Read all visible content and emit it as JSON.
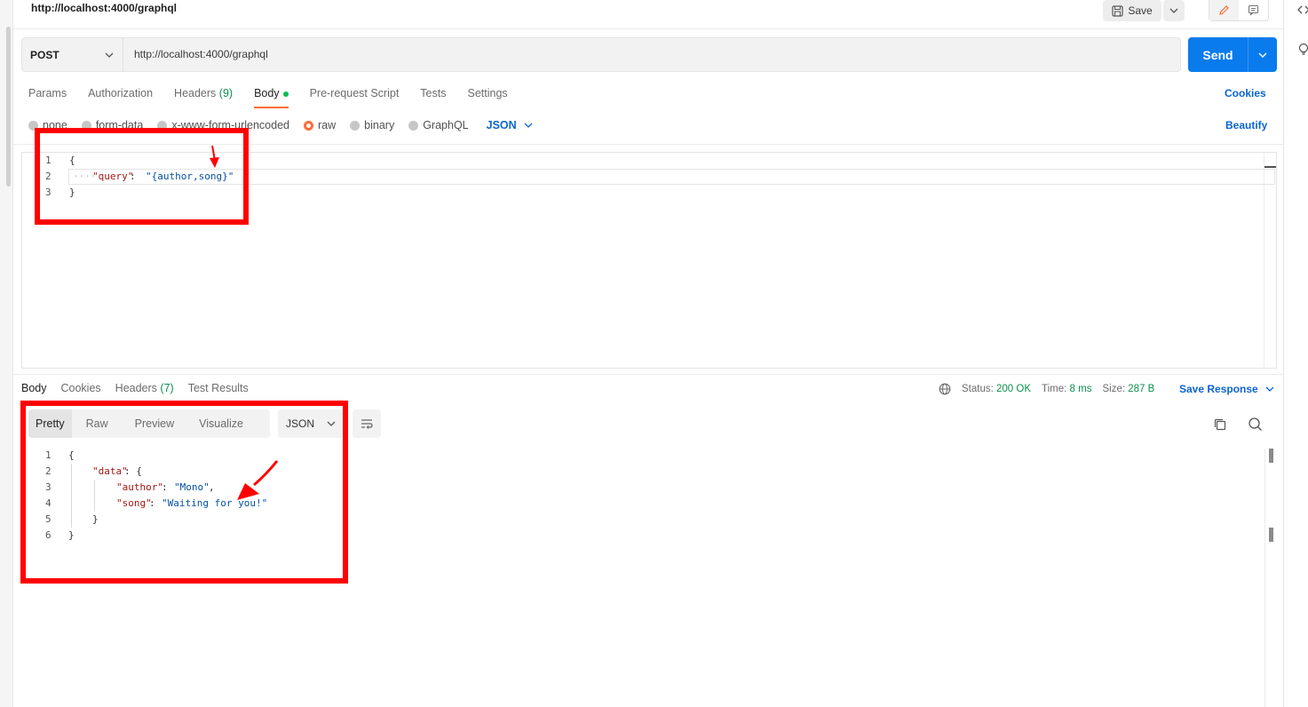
{
  "header": {
    "title": "http://localhost:4000/graphql",
    "save_label": "Save"
  },
  "request": {
    "method": "POST",
    "url": "http://localhost:4000/graphql",
    "send_label": "Send",
    "tabs": [
      {
        "label": "Params"
      },
      {
        "label": "Authorization"
      },
      {
        "label": "Headers",
        "count": "(9)"
      },
      {
        "label": "Body"
      },
      {
        "label": "Pre-request Script"
      },
      {
        "label": "Tests"
      },
      {
        "label": "Settings"
      }
    ],
    "cookies_label": "Cookies",
    "body_types": [
      "none",
      "form-data",
      "x-www-form-urlencoded",
      "raw",
      "binary",
      "GraphQL"
    ],
    "selected_body_type": "raw",
    "raw_format": "JSON",
    "beautify_label": "Beautify",
    "editor": {
      "line_numbers": [
        "1",
        "2",
        "3"
      ],
      "open_brace": "{",
      "key": "\"query\"",
      "colon": ": ",
      "value": "\"{author,song}\"",
      "close_brace": "}"
    }
  },
  "response": {
    "tabs": [
      {
        "label": "Body"
      },
      {
        "label": "Cookies"
      },
      {
        "label": "Headers",
        "count": "(7)"
      },
      {
        "label": "Test Results"
      }
    ],
    "status_label": "Status:",
    "status_value": "200 OK",
    "time_label": "Time:",
    "time_value": "8 ms",
    "size_label": "Size:",
    "size_value": "287 B",
    "save_response_label": "Save Response",
    "view_tabs": [
      "Pretty",
      "Raw",
      "Preview",
      "Visualize"
    ],
    "format": "JSON",
    "body": {
      "line_numbers": [
        "1",
        "2",
        "3",
        "4",
        "5",
        "6"
      ],
      "open_brace": "{",
      "data_key": "\"data\"",
      "data_open": ": {",
      "author_key": "\"author\"",
      "author_value": "\"Mono\"",
      "song_key": "\"song\"",
      "song_value": "\"Waiting for you!\"",
      "inner_close": "}",
      "close_brace": "}"
    }
  },
  "colors": {
    "accent": "#ff6c37",
    "send": "#097bed",
    "link": "#0b64d1",
    "success": "#0c8e4e",
    "annotation": "#ff0000"
  },
  "icons": [
    "save-icon",
    "chevron-down-icon",
    "pencil-icon",
    "comment-icon",
    "code-icon",
    "lightbulb-icon",
    "globe-icon",
    "copy-icon",
    "search-icon",
    "wrap-lines-icon",
    "annotation-arrow"
  ]
}
